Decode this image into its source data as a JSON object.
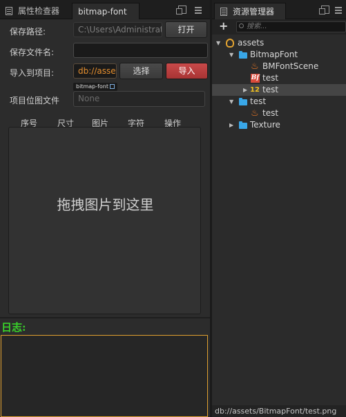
{
  "inspector": {
    "tabs": [
      {
        "label": "属性检查器",
        "icon": "inspector-icon"
      },
      {
        "label": "bitmap-font"
      }
    ],
    "save_path": {
      "label": "保存路径:",
      "value": "C:\\Users\\Administrato",
      "button": "打开"
    },
    "save_filename": {
      "label": "保存文件名:",
      "value": ""
    },
    "import_project": {
      "label": "导入到项目:",
      "value": "db://asse",
      "select_button": "选择",
      "import_button": "导入"
    },
    "bitmap_file": {
      "label": "项目位图文件",
      "tag": "bitmap-font",
      "value": "None"
    },
    "table_headers": [
      "序号",
      "尺寸",
      "图片",
      "字符",
      "操作"
    ],
    "drop_text": "拖拽图片到这里",
    "log_label": "日志:"
  },
  "assets": {
    "tab": {
      "label": "资源管理器",
      "icon": "assets-icon"
    },
    "search_placeholder": "搜索...",
    "tree": [
      {
        "label": "assets",
        "icon": "database-icon",
        "arrow": "▼"
      },
      {
        "label": "BitmapFont",
        "icon": "folder-icon",
        "arrow": "▼"
      },
      {
        "label": "BMFontScene",
        "icon": "fire-scene-icon",
        "arrow": ""
      },
      {
        "label": "test",
        "icon": "bitmap-font-icon",
        "icon_text": "Bf",
        "arrow": ""
      },
      {
        "label": "test",
        "icon": "label-atlas-icon",
        "icon_text": "12",
        "arrow": "▶",
        "selected": true
      },
      {
        "label": "test",
        "icon": "folder-icon",
        "arrow": "▼"
      },
      {
        "label": "test",
        "icon": "fire-scene-icon",
        "arrow": ""
      },
      {
        "label": "Texture",
        "icon": "folder-icon",
        "arrow": "▶"
      }
    ],
    "status_path": "db://assets/BitmapFont/test.png"
  },
  "colors": {
    "accent_red": "#b83c3c",
    "log_green": "#39d32a",
    "folder_blue": "#39a7e8",
    "url_orange": "#e8902e",
    "log_border": "#e0a030"
  }
}
